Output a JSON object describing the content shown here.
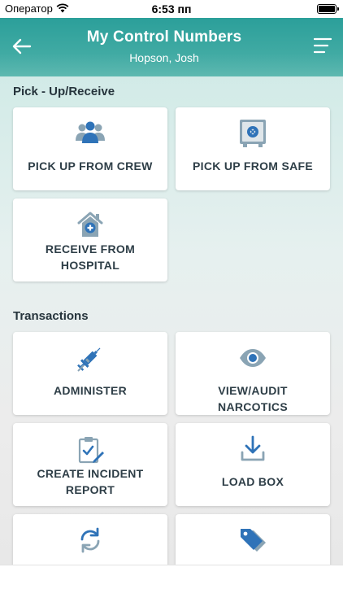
{
  "status_bar": {
    "carrier": "Оператор",
    "time": "6:53 пп"
  },
  "header": {
    "title": "My Control Numbers",
    "subtitle": "Hopson, Josh"
  },
  "sections": {
    "pickup": {
      "title": "Pick - Up/Receive",
      "tiles": [
        {
          "label": "PICK UP FROM CREW",
          "icon": "crew-icon"
        },
        {
          "label": "PICK UP FROM SAFE",
          "icon": "safe-icon"
        },
        {
          "label_line1": "RECEIVE FROM",
          "label_line2": "HOSPITAL",
          "icon": "hospital-icon"
        }
      ]
    },
    "transactions": {
      "title": "Transactions",
      "tiles": [
        {
          "label": "ADMINISTER",
          "icon": "syringe-icon"
        },
        {
          "label": "VIEW/AUDIT NARCOTICS",
          "icon": "eye-icon"
        },
        {
          "label_line1": "CREATE INCIDENT",
          "label_line2": "REPORT",
          "icon": "clipboard-pen-icon"
        },
        {
          "label": "LOAD BOX",
          "icon": "download-icon"
        },
        {
          "label": "",
          "icon": "refresh-icon"
        },
        {
          "label": "",
          "icon": "tag-icon"
        }
      ]
    }
  },
  "colors": {
    "header": "#3aa7a0",
    "icon_blue": "#2f73b8",
    "icon_gray": "#7f98a8",
    "text_dark": "#2e3e47"
  }
}
